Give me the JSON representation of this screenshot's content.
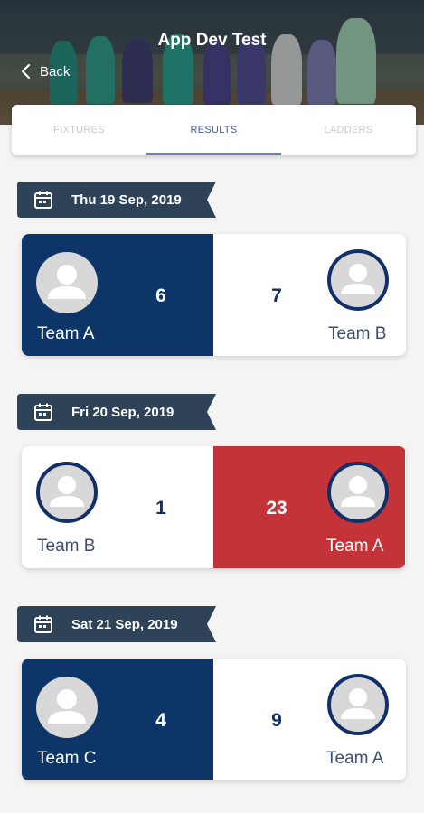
{
  "header": {
    "title": "App Dev Test",
    "back_label": "Back"
  },
  "tabs": [
    {
      "label": "FIXTURES",
      "active": false
    },
    {
      "label": "RESULTS",
      "active": true
    },
    {
      "label": "LADDERS",
      "active": false
    }
  ],
  "colors": {
    "win_home": "#0e3567",
    "win_away": "#c43338",
    "banner": "#2e4357"
  },
  "results": [
    {
      "date": "Thu 19 Sep, 2019",
      "home": {
        "name": "Team A",
        "score": "6"
      },
      "away": {
        "name": "Team B",
        "score": "7"
      },
      "highlight": "home"
    },
    {
      "date": "Fri 20 Sep, 2019",
      "home": {
        "name": "Team B",
        "score": "1"
      },
      "away": {
        "name": "Team A",
        "score": "23"
      },
      "highlight": "away"
    },
    {
      "date": "Sat 21 Sep, 2019",
      "home": {
        "name": "Team C",
        "score": "4"
      },
      "away": {
        "name": "Team A",
        "score": "9"
      },
      "highlight": "home"
    }
  ]
}
